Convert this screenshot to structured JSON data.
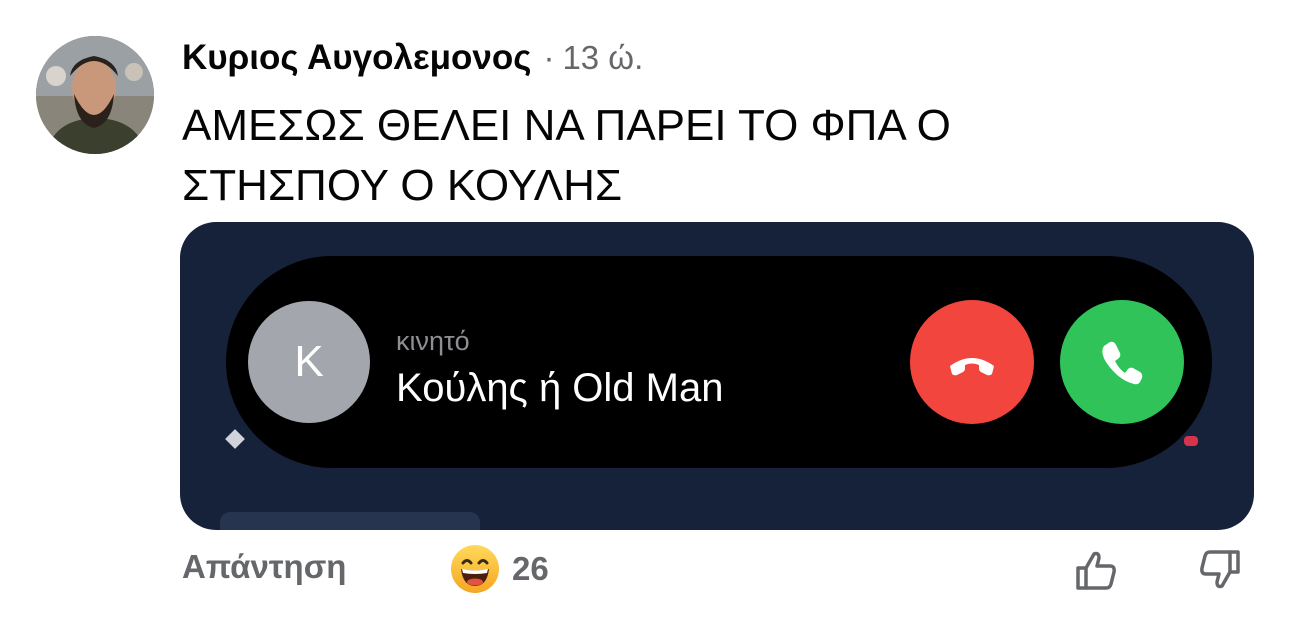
{
  "comment": {
    "author": "Κυριος Αυγολεμονος",
    "separator": "·",
    "timestamp": "13 ώ.",
    "text_lines": [
      "ΑΜΕΣΩΣ ΘΕΛΕΙ ΝΑ ΠΑΡΕΙ ΤΟ ΦΠΑ Ο",
      "ΣΤΗΣΠΟΥ Ο ΚΟΥΛΗΣ"
    ]
  },
  "attachment": {
    "call_screen": {
      "caller_initial": "K",
      "caller_type": "κινητό",
      "caller_name": "Κούλης ή Old Man",
      "decline_icon": "phone-hangup-icon",
      "accept_icon": "phone-icon",
      "decline_color": "#f2453d",
      "accept_color": "#30c35a"
    }
  },
  "actions": {
    "reply_label": "Απάντηση",
    "reaction_icon": "laughing-face-icon",
    "reaction_count": "26",
    "upvote_icon": "thumbs-up-icon",
    "downvote_icon": "thumbs-down-icon"
  }
}
